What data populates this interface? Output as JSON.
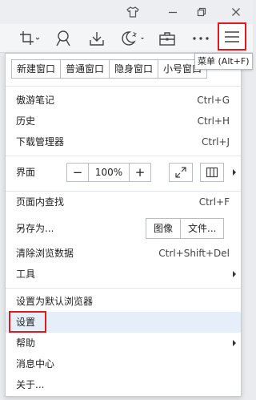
{
  "colors": {
    "highlight": "#e0191d",
    "hover_bg": "#e6eef9"
  },
  "titlebar": {
    "icons": [
      "skin-icon",
      "minimize-icon",
      "restore-icon",
      "close-icon"
    ]
  },
  "toolbar": {
    "icons": [
      "crop-icon",
      "search-person-icon",
      "download-icon",
      "night-mode-icon",
      "toolbox-icon",
      "more-icon",
      "menu-icon"
    ]
  },
  "tooltip": {
    "text": "菜单 (Alt+F)"
  },
  "menu": {
    "new_window": {
      "label": "新建窗口",
      "normal": "普通窗口",
      "private": "隐身窗口",
      "small": "小号窗口"
    },
    "items_1": [
      {
        "label": "傲游笔记",
        "shortcut": "Ctrl+G"
      },
      {
        "label": "历史",
        "shortcut": "Ctrl+H"
      },
      {
        "label": "下载管理器",
        "shortcut": "Ctrl+J"
      }
    ],
    "view": {
      "label": "界面",
      "minus": "−",
      "zoom_value": "100%",
      "plus": "+"
    },
    "find": {
      "label": "页面内查找",
      "shortcut": "Ctrl+F"
    },
    "save_as": {
      "label": "另存为...",
      "image": "图像",
      "file": "文件..."
    },
    "clear": {
      "label": "清除浏览数据",
      "shortcut": "Ctrl+Shift+Del"
    },
    "tools": {
      "label": "工具"
    },
    "items_3": [
      {
        "label": "设置为默认浏览器"
      },
      {
        "label": "设置"
      },
      {
        "label": "帮助"
      },
      {
        "label": "消息中心"
      },
      {
        "label": "关于..."
      }
    ]
  }
}
